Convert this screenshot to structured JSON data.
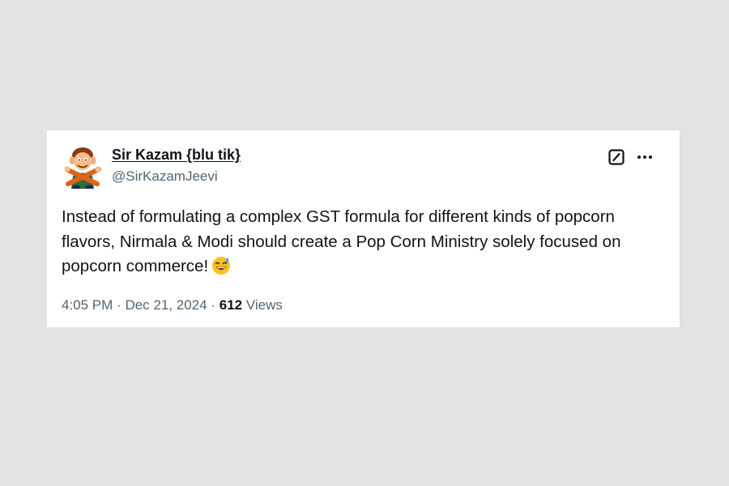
{
  "tweet": {
    "author": {
      "display_name": "Sir Kazam {blu tik}",
      "handle": "@SirKazamJeevi",
      "avatar_icon": "cartoon-avatar-icon"
    },
    "header_icons": [
      "grok-icon",
      "more-options-icon"
    ],
    "text": "Instead of formulating a complex GST formula for different kinds of popcorn flavors, Nirmala & Modi should create a Pop Corn Ministry solely focused on popcorn commerce!",
    "text_emoji": "grinning-face-with-sweat-emoji",
    "time": "4:05 PM",
    "separator": "·",
    "date": "Dec 21, 2024",
    "views_count": "612",
    "views_label": "Views"
  },
  "colors": {
    "background": "#e3e3e3",
    "card": "#ffffff",
    "primary_text": "#0f1419",
    "secondary_text": "#536471"
  }
}
